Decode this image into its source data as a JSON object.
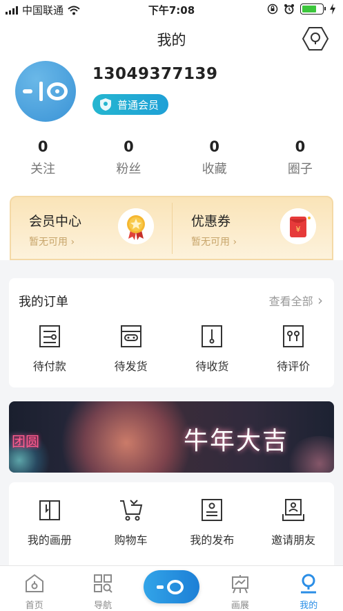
{
  "status_bar": {
    "carrier": "中国联通",
    "time": "下午7:08",
    "battery_level": 0.7
  },
  "header": {
    "title": "我的"
  },
  "profile": {
    "phone": "13049377139",
    "member_level": "普通会员"
  },
  "stats": [
    {
      "value": "0",
      "label": "关注"
    },
    {
      "value": "0",
      "label": "粉丝"
    },
    {
      "value": "0",
      "label": "收藏"
    },
    {
      "value": "0",
      "label": "圈子"
    }
  ],
  "vip": {
    "member_center": {
      "title": "会员中心",
      "subtitle": "暂无可用"
    },
    "coupon": {
      "title": "优惠券",
      "subtitle": "暂无可用"
    }
  },
  "orders": {
    "title": "我的订单",
    "view_all": "查看全部",
    "items": [
      {
        "label": "待付款",
        "icon": "payment-icon"
      },
      {
        "label": "待发货",
        "icon": "shipping-icon"
      },
      {
        "label": "待收货",
        "icon": "receive-icon"
      },
      {
        "label": "待评价",
        "icon": "review-icon"
      }
    ]
  },
  "banner": {
    "text": "牛年大吉",
    "left_text": "团圆"
  },
  "tools": [
    {
      "label": "我的画册",
      "icon": "album-icon"
    },
    {
      "label": "购物车",
      "icon": "cart-icon"
    },
    {
      "label": "我的发布",
      "icon": "publish-icon"
    },
    {
      "label": "邀请朋友",
      "icon": "invite-icon"
    }
  ],
  "tabbar": [
    {
      "label": "首页",
      "icon": "home-icon"
    },
    {
      "label": "导航",
      "icon": "nav-icon"
    },
    {
      "label": "",
      "icon": "logo-icon"
    },
    {
      "label": "画展",
      "icon": "exhibition-icon"
    },
    {
      "label": "我的",
      "icon": "profile-icon",
      "active": true
    }
  ],
  "colors": {
    "accent": "#2b8ee6",
    "member_badge": "#1fa0d6",
    "vip_gold": "#c7a56b"
  }
}
